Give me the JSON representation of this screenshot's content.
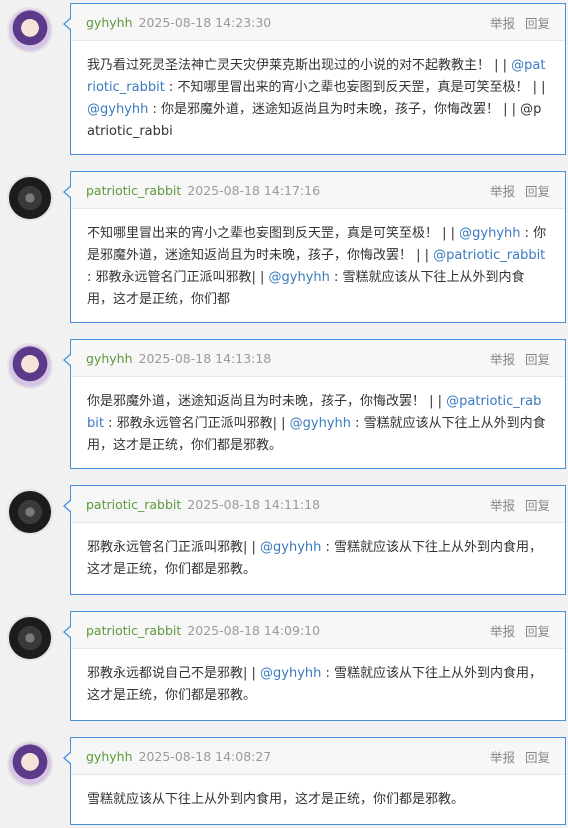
{
  "actions": {
    "report": "举报",
    "reply": "回复"
  },
  "comments": [
    {
      "user": "gyhyhh",
      "time": "2025-08-18 14:23:30",
      "avatar": "gy",
      "text": [
        {
          "t": "我乃看过死灵圣法神亡灵天灾伊莱克斯出现过的小说的对不起教教主！ | | "
        },
        {
          "t": "@patriotic_rabbit",
          "m": true
        },
        {
          "t": " : 不知哪里冒出来的宵小之辈也妄图到反天罡，真是可笑至极！ | | "
        },
        {
          "t": "@gyhyhh",
          "m": true
        },
        {
          "t": " : 你是邪魔外道，迷途知返尚且为时未晚，孩子，你悔改罢！ | | @patriotic_rabbi"
        }
      ]
    },
    {
      "user": "patriotic_rabbit",
      "time": "2025-08-18 14:17:16",
      "avatar": "pr",
      "text": [
        {
          "t": "不知哪里冒出来的宵小之辈也妄图到反天罡，真是可笑至极！ | | "
        },
        {
          "t": "@gyhyhh",
          "m": true
        },
        {
          "t": " : 你是邪魔外道，迷途知返尚且为时未晚，孩子，你悔改罢！ | | "
        },
        {
          "t": "@patriotic_rabbit",
          "m": true
        },
        {
          "t": " : 邪教永远管名门正派叫邪教| | "
        },
        {
          "t": "@gyhyhh",
          "m": true
        },
        {
          "t": " : 雪糕就应该从下往上从外到内食用，这才是正统，你们都"
        }
      ]
    },
    {
      "user": "gyhyhh",
      "time": "2025-08-18 14:13:18",
      "avatar": "gy",
      "text": [
        {
          "t": "你是邪魔外道，迷途知返尚且为时未晚，孩子，你悔改罢！ | | "
        },
        {
          "t": "@patriotic_rabbit",
          "m": true
        },
        {
          "t": " : 邪教永远管名门正派叫邪教| | "
        },
        {
          "t": "@gyhyhh",
          "m": true
        },
        {
          "t": " : 雪糕就应该从下往上从外到内食用，这才是正统，你们都是邪教。"
        }
      ]
    },
    {
      "user": "patriotic_rabbit",
      "time": "2025-08-18 14:11:18",
      "avatar": "pr",
      "text": [
        {
          "t": "邪教永远管名门正派叫邪教| | "
        },
        {
          "t": "@gyhyhh",
          "m": true
        },
        {
          "t": " : 雪糕就应该从下往上从外到内食用，这才是正统，你们都是邪教。"
        }
      ]
    },
    {
      "user": "patriotic_rabbit",
      "time": "2025-08-18 14:09:10",
      "avatar": "pr",
      "text": [
        {
          "t": "邪教永远都说自己不是邪教| | "
        },
        {
          "t": "@gyhyhh",
          "m": true
        },
        {
          "t": " : 雪糕就应该从下往上从外到内食用，这才是正统，你们都是邪教。"
        }
      ]
    },
    {
      "user": "gyhyhh",
      "time": "2025-08-18 14:08:27",
      "avatar": "gy",
      "text": [
        {
          "t": "雪糕就应该从下往上从外到内食用，这才是正统，你们都是邪教。"
        }
      ]
    }
  ]
}
